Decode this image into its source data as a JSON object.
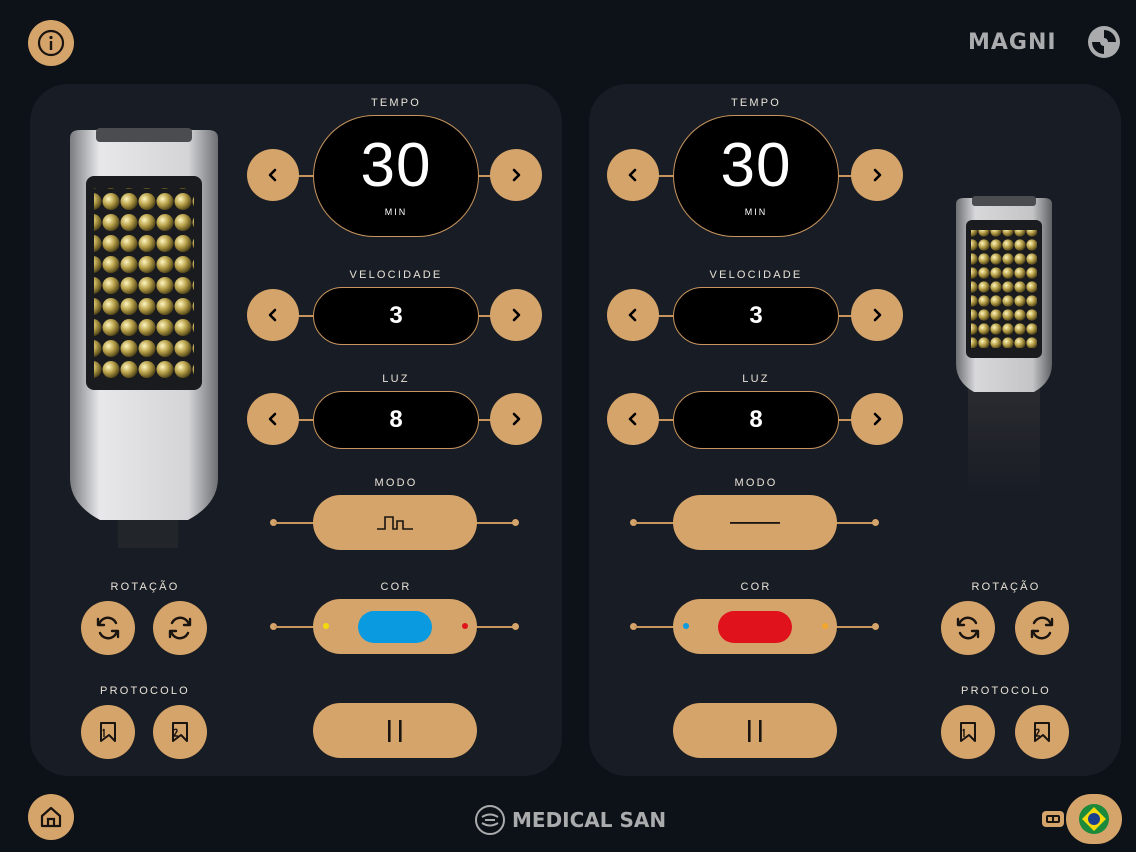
{
  "brand": {
    "logo": "MAGNI",
    "footer": "MEDICAL SAN"
  },
  "colors": {
    "gold": "#d5a46a",
    "blue": "#0a9ae0",
    "red": "#e0131c",
    "yellow": "#f4d90c",
    "orange": "#f2a72c"
  },
  "left": {
    "tempo_label": "TEMPO",
    "tempo_value": "30",
    "tempo_unit": "MIN",
    "velocidade_label": "VELOCIDADE",
    "velocidade_value": "3",
    "luz_label": "LUZ",
    "luz_value": "8",
    "modo_label": "MODO",
    "modo_icon": "pulse-wave-icon",
    "cor_label": "COR",
    "cor_value": "blue",
    "rotacao_label": "ROTAÇÃO",
    "protocolo_label": "PROTOCOLO"
  },
  "right": {
    "tempo_label": "TEMPO",
    "tempo_value": "30",
    "tempo_unit": "MIN",
    "velocidade_label": "VELOCIDADE",
    "velocidade_value": "3",
    "luz_label": "LUZ",
    "luz_value": "8",
    "modo_label": "MODO",
    "modo_icon": "continuous-line-icon",
    "cor_label": "COR",
    "cor_value": "red",
    "rotacao_label": "ROTAÇÃO",
    "protocolo_label": "PROTOCOLO"
  }
}
